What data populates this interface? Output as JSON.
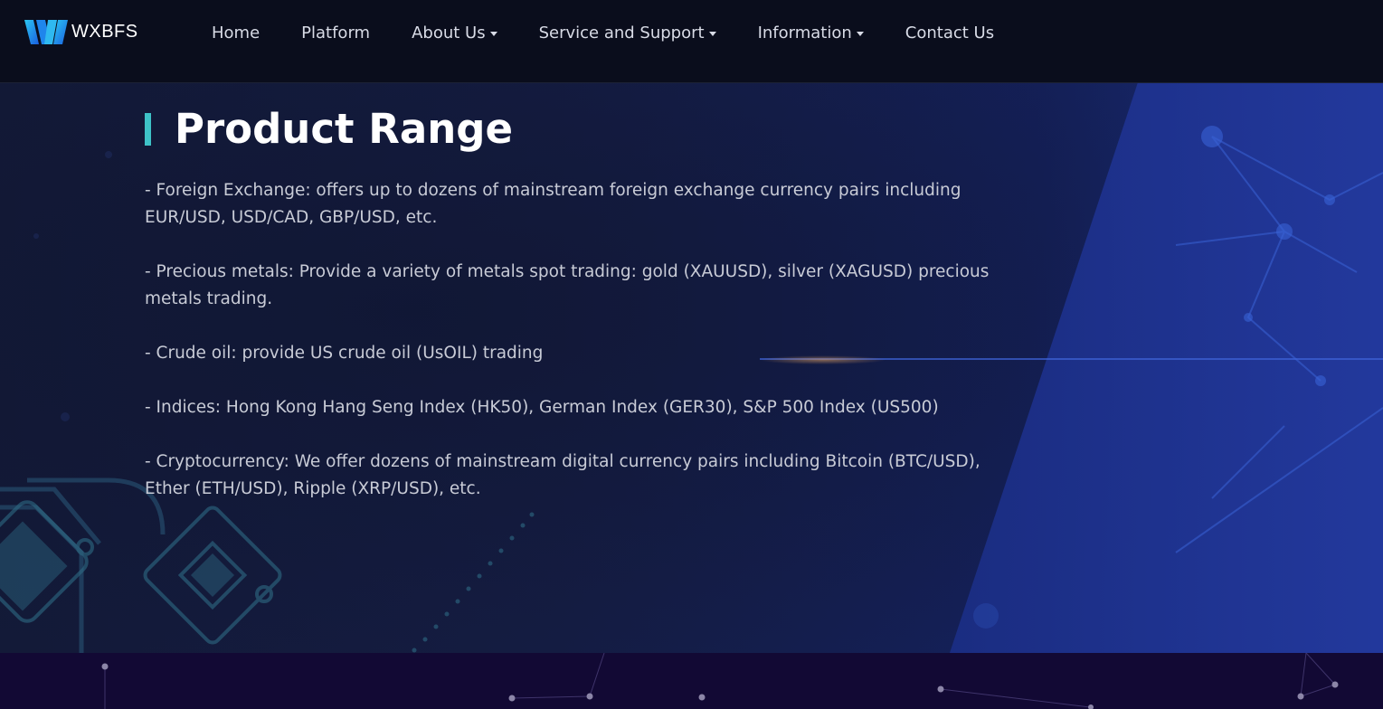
{
  "header": {
    "brand": "WXBFS",
    "nav": [
      {
        "label": "Home",
        "dropdown": false
      },
      {
        "label": "Platform",
        "dropdown": false
      },
      {
        "label": "About Us",
        "dropdown": true
      },
      {
        "label": "Service and Support",
        "dropdown": true
      },
      {
        "label": "Information",
        "dropdown": true
      },
      {
        "label": "Contact Us",
        "dropdown": false
      }
    ]
  },
  "section": {
    "title": "Product Range",
    "items": [
      "- Foreign Exchange: offers up to dozens of mainstream foreign exchange currency pairs including EUR/USD, USD/CAD, GBP/USD, etc.",
      "- Precious metals: Provide a variety of metals spot trading: gold (XAUUSD), silver (XAGUSD) precious metals trading.",
      "- Crude oil: provide US crude oil (UsOIL) trading",
      "- Indices: Hong Kong Hang Seng Index (HK50), German Index (GER30), S&P 500 Index (US500)",
      "- Cryptocurrency: We offer dozens of mainstream digital currency pairs including Bitcoin (BTC/USD), Ether (ETH/USD), Ripple (XRP/USD), etc."
    ]
  },
  "colors": {
    "accent": "#3ec2c7",
    "header_bg": "#0a0d1c",
    "footer_bg": "#120934"
  }
}
